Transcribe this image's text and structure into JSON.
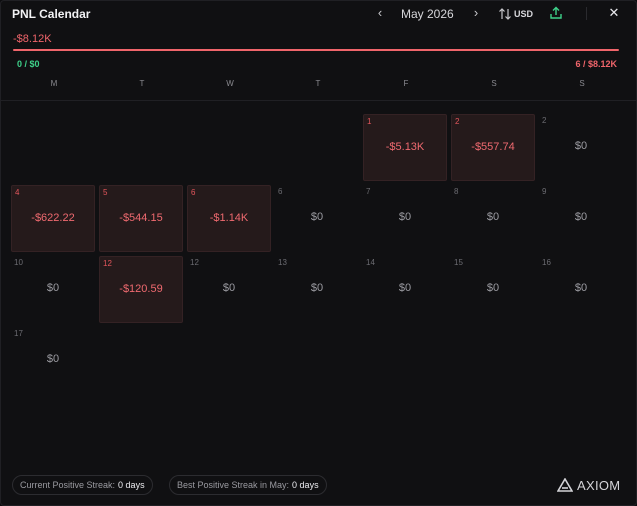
{
  "header": {
    "title": "PNL Calendar",
    "month": "May 2026",
    "prev_glyph": "‹",
    "next_glyph": "›",
    "currency": "USD",
    "close_glyph": "✕"
  },
  "summary": {
    "total": "-$8.12K",
    "wins": "0 / $0",
    "losses": "6 / $8.12K",
    "win_fraction": 0
  },
  "weekdays": [
    "M",
    "T",
    "W",
    "T",
    "F",
    "S",
    "S"
  ],
  "days": [
    {
      "day": "1",
      "amount": "-$5.13K",
      "status": "loss",
      "col": 4,
      "row": 0
    },
    {
      "day": "2",
      "amount": "-$557.74",
      "status": "loss",
      "col": 5,
      "row": 0
    },
    {
      "day": "2",
      "amount": "$0",
      "status": "zero",
      "col": 6,
      "row": 0
    },
    {
      "day": "4",
      "amount": "-$622.22",
      "status": "loss",
      "col": 0,
      "row": 1
    },
    {
      "day": "5",
      "amount": "-$544.15",
      "status": "loss",
      "col": 1,
      "row": 1
    },
    {
      "day": "6",
      "amount": "-$1.14K",
      "status": "loss",
      "col": 2,
      "row": 1
    },
    {
      "day": "6",
      "amount": "$0",
      "status": "zero",
      "col": 3,
      "row": 1
    },
    {
      "day": "7",
      "amount": "$0",
      "status": "zero",
      "col": 4,
      "row": 1
    },
    {
      "day": "8",
      "amount": "$0",
      "status": "zero",
      "col": 5,
      "row": 1
    },
    {
      "day": "9",
      "amount": "$0",
      "status": "zero",
      "col": 6,
      "row": 1
    },
    {
      "day": "10",
      "amount": "$0",
      "status": "zero",
      "col": 0,
      "row": 2
    },
    {
      "day": "12",
      "amount": "-$120.59",
      "status": "loss",
      "col": 1,
      "row": 2
    },
    {
      "day": "12",
      "amount": "$0",
      "status": "zero",
      "col": 2,
      "row": 2
    },
    {
      "day": "13",
      "amount": "$0",
      "status": "zero",
      "col": 3,
      "row": 2
    },
    {
      "day": "14",
      "amount": "$0",
      "status": "zero",
      "col": 4,
      "row": 2
    },
    {
      "day": "15",
      "amount": "$0",
      "status": "zero",
      "col": 5,
      "row": 2
    },
    {
      "day": "16",
      "amount": "$0",
      "status": "zero",
      "col": 6,
      "row": 2
    },
    {
      "day": "17",
      "amount": "$0",
      "status": "zero",
      "col": 0,
      "row": 3
    }
  ],
  "footer": {
    "current_streak_label": "Current Positive Streak:",
    "current_streak_value": "0 days",
    "best_streak_label": "Best Positive Streak in May:",
    "best_streak_value": "0 days",
    "brand": "AXIOM"
  },
  "colors": {
    "loss": "#f0656b",
    "win": "#3ed28a",
    "loss_cell_bg": "#251a1b"
  },
  "icons": {
    "sort": "sort-arrows-icon",
    "share": "share-upload-icon",
    "close": "close-icon",
    "prev": "chevron-left-icon",
    "next": "chevron-right-icon",
    "logo": "axiom-logo-icon"
  }
}
